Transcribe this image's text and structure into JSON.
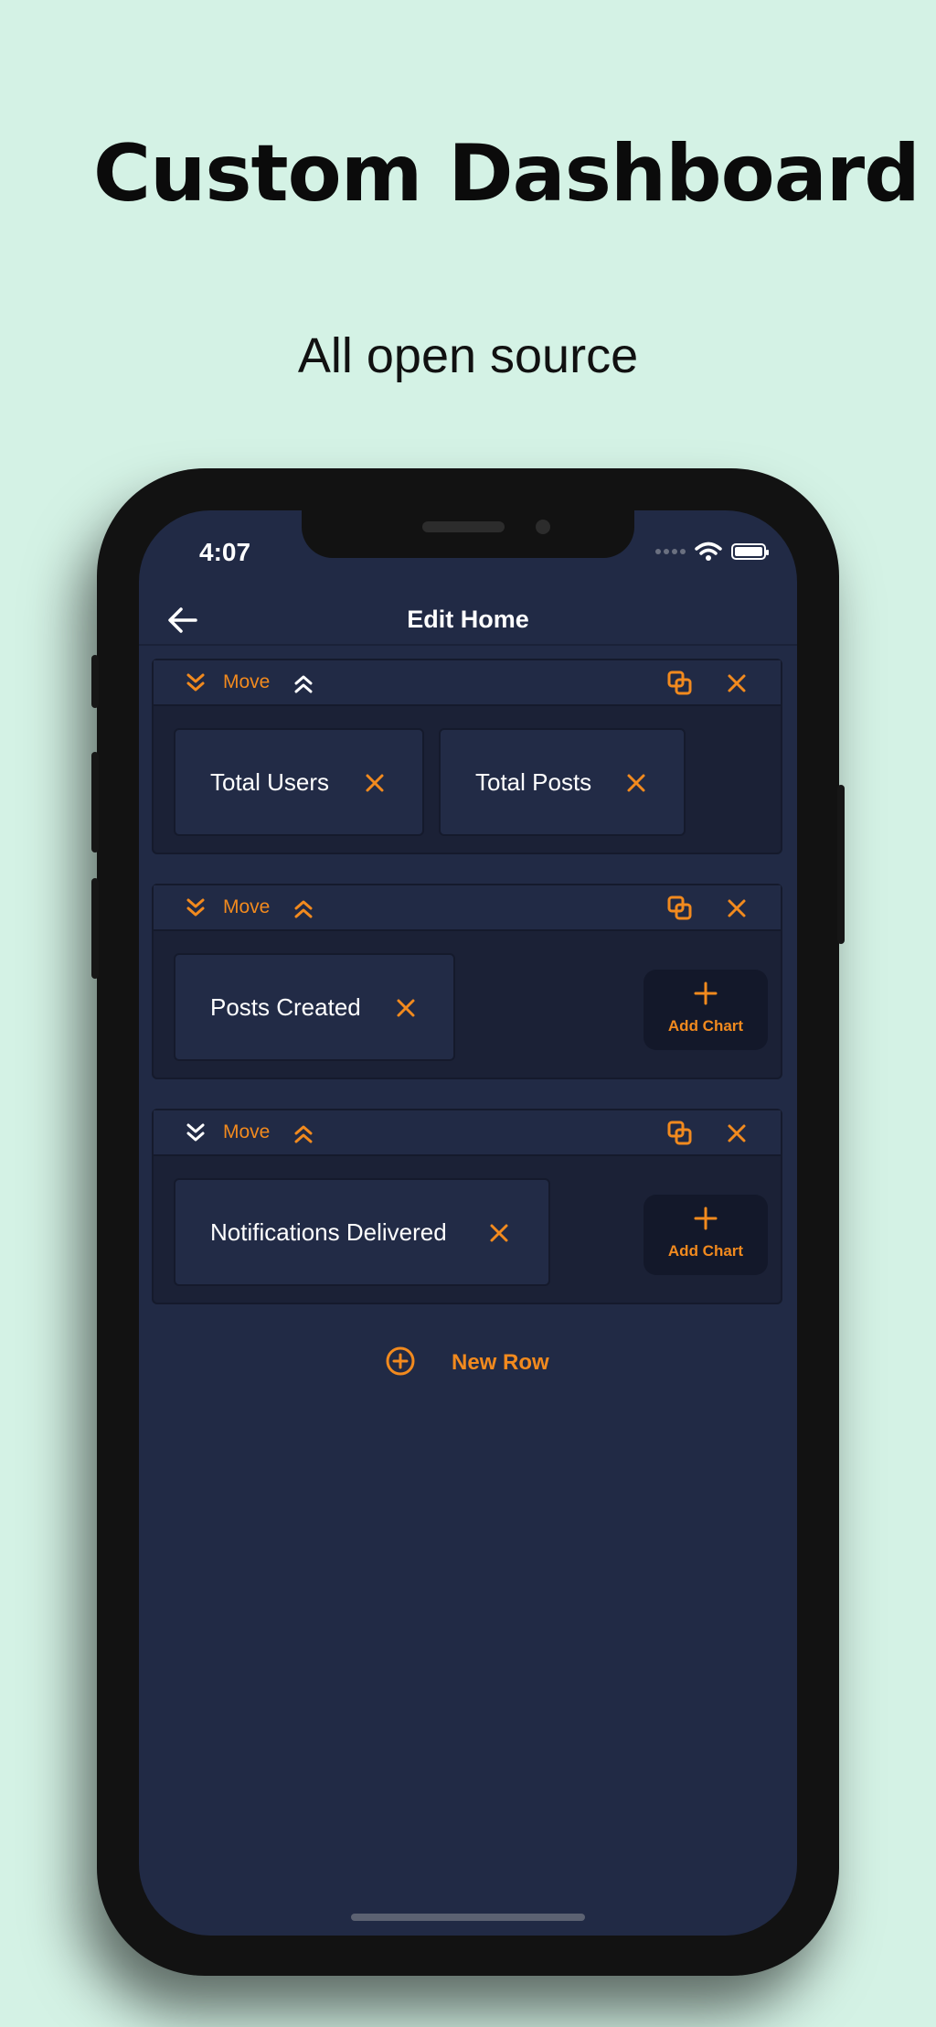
{
  "colors": {
    "background": "#d4f2e5",
    "screen": "#212a45",
    "accent": "#f28a1e",
    "text": "#ffffff"
  },
  "promo": {
    "headline": "Custom Dashboard",
    "subheadline": "All open source"
  },
  "status_bar": {
    "time": "4:07",
    "icons": [
      "signal-dots-icon",
      "wifi-icon",
      "battery-icon"
    ]
  },
  "nav": {
    "back_icon": "arrow-left-icon",
    "title": "Edit Home"
  },
  "rows": [
    {
      "move_label": "Move",
      "charts": [
        {
          "label": "Total Users"
        },
        {
          "label": "Total Posts"
        }
      ],
      "add_chart": null
    },
    {
      "move_label": "Move",
      "charts": [
        {
          "label": "Posts Created"
        }
      ],
      "add_chart": "Add Chart"
    },
    {
      "move_label": "Move",
      "charts": [
        {
          "label": "Notifications Delivered"
        }
      ],
      "add_chart": "Add Chart"
    }
  ],
  "new_row": {
    "label": "New Row",
    "icon": "plus-circle-icon"
  }
}
